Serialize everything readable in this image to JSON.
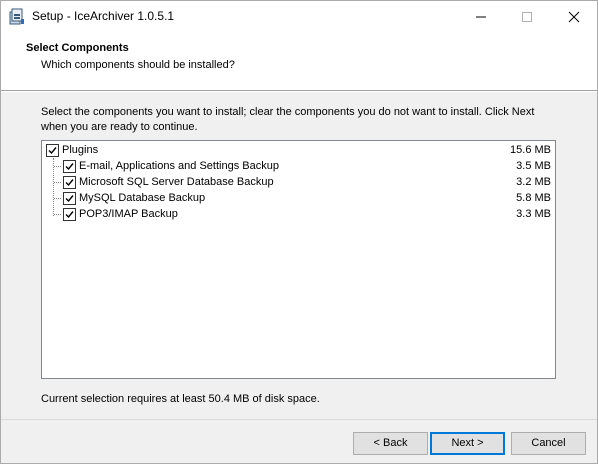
{
  "window": {
    "title": "Setup - IceArchiver 1.0.5.1"
  },
  "header": {
    "title": "Select Components",
    "subtitle": "Which components should be installed?"
  },
  "instructions": "Select the components you want to install; clear the components you do not want to install. Click Next when you are ready to continue.",
  "components": [
    {
      "label": "Plugins",
      "size": "15.6 MB",
      "checked": true,
      "level": 0
    },
    {
      "label": "E-mail, Applications and Settings Backup",
      "size": "3.5 MB",
      "checked": true,
      "level": 1
    },
    {
      "label": "Microsoft SQL Server Database Backup",
      "size": "3.2 MB",
      "checked": true,
      "level": 1
    },
    {
      "label": "MySQL Database Backup",
      "size": "5.8 MB",
      "checked": true,
      "level": 1
    },
    {
      "label": "POP3/IMAP Backup",
      "size": "3.3 MB",
      "checked": true,
      "level": 1
    }
  ],
  "disk_space": "Current selection requires at least 50.4 MB of disk space.",
  "buttons": {
    "back": "< Back",
    "next": "Next >",
    "cancel": "Cancel"
  },
  "colors": {
    "default_button_border": "#0078d7",
    "dialog_background": "#f0f0f0"
  },
  "icons": {
    "app": "installer-box-icon",
    "minimize": "minimize-icon",
    "maximize": "maximize-icon",
    "close": "close-icon",
    "checkbox": "checkmark-icon"
  }
}
